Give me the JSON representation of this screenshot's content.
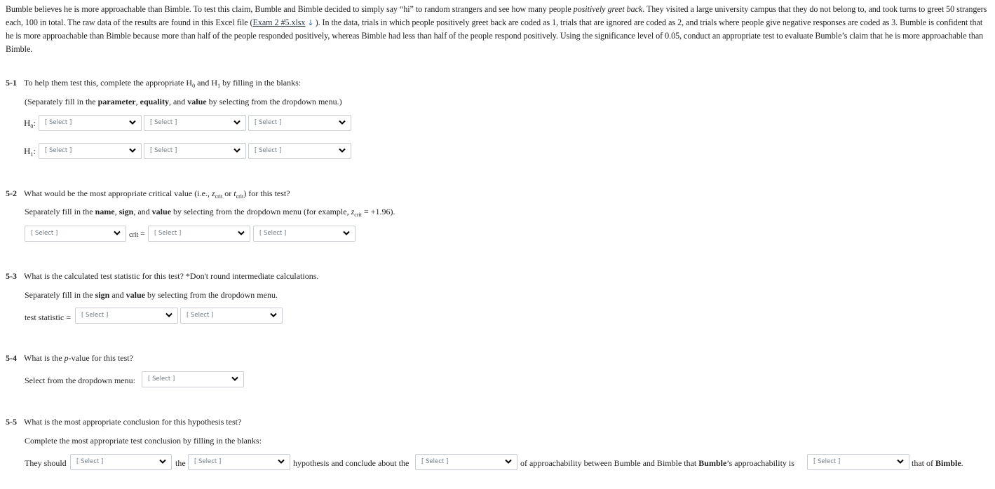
{
  "intro": {
    "part1": "Bumble believes he is more approachable than Bimble. To test this claim, Bumble and Bimble decided to simply say “hi” to random strangers and see how many people ",
    "emph": "positively greet back",
    "part2": ". They visited a large university campus that they do not belong to, and took turns to greet 50 strangers each, 100 in total. The raw data of the results are found in this Excel file (",
    "file_link": "Exam 2 #5.xlsx",
    "file_icon": "download-icon",
    "part3": "). In the data, trials in which people positively greet back are coded as 1, trials that are ignored are coded as 2, and trials where people give negative responses are coded as 3. Bumble is confident that he is more approachable than Bimble because more than half of the people responded positively, whereas Bimble had less than half of the people respond positively. Using the significance level of 0.05, conduct an appropriate test to evaluate Bumble’s claim that he is more approachable than Bimble."
  },
  "select_placeholder": "[ Select ]",
  "q1": {
    "num": "5-1",
    "text_a": "To help them test this, complete the appropriate H",
    "sub0": "0",
    "text_b": " and H",
    "sub1": "1",
    "text_c": " by filling in the blanks:",
    "instr_a": "(Separately fill in the ",
    "instr_b1": "parameter",
    "instr_c": ", ",
    "instr_b2": "equality",
    "instr_d": ", and ",
    "instr_b3": "value",
    "instr_e": " by selecting from the dropdown menu.)",
    "h0_label": "H",
    "h0_sub": "0",
    "h1_label": "H",
    "h1_sub": "1",
    "colon": ":"
  },
  "q2": {
    "num": "5-2",
    "text_a": "What would be the most appropriate critical value (i.e., ",
    "z": "z",
    "crit": "crit",
    "or": " or ",
    "t": "t",
    "text_b": ") for this test?",
    "instr_a": "Separately fill in the ",
    "instr_b1": "name",
    "instr_c": ", ",
    "instr_b2": "sign",
    "instr_d": ", and ",
    "instr_b3": "value",
    "instr_e": " by selecting from the dropdown menu (for example, ",
    "example_z": "z",
    "example_sub": "crit",
    "example_val": " = +1.96).",
    "crit_label": "crit",
    "equals": "="
  },
  "q3": {
    "num": "5-3",
    "text": "What is the calculated test statistic for this test? *Don't round intermediate calculations.",
    "instr_a": "Separately fill in the ",
    "instr_b1": "sign",
    "instr_c": " and ",
    "instr_b2": "value",
    "instr_d": " by selecting from the dropdown menu.",
    "label": "test statistic ="
  },
  "q4": {
    "num": "5-4",
    "text_a": "What is the ",
    "p": "p",
    "text_b": "-value for this test?",
    "label": "Select from the dropdown menu:"
  },
  "q5": {
    "num": "5-5",
    "text": "What is the most appropriate conclusion for this hypothesis test?",
    "instr": "Complete the most appropriate test conclusion by filling in the blanks:",
    "w1": "They should",
    "w2": "the",
    "w3": "hypothesis and conclude about the",
    "w4a": "of approachability between Bumble and Bimble that ",
    "w4b": "Bumble",
    "w4c": "’s approachability is",
    "w5a": "that of ",
    "w5b": "Bimble",
    "w5c": "."
  }
}
